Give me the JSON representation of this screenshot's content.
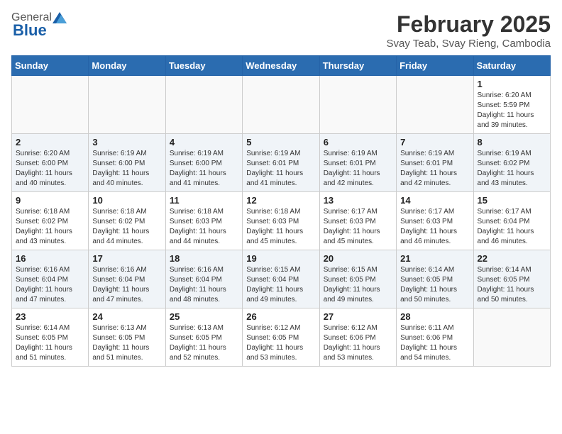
{
  "header": {
    "logo_general": "General",
    "logo_blue": "Blue",
    "month_title": "February 2025",
    "location": "Svay Teab, Svay Rieng, Cambodia"
  },
  "weekdays": [
    "Sunday",
    "Monday",
    "Tuesday",
    "Wednesday",
    "Thursday",
    "Friday",
    "Saturday"
  ],
  "weeks": [
    [
      {
        "day": "",
        "sunrise": "",
        "sunset": "",
        "daylight": ""
      },
      {
        "day": "",
        "sunrise": "",
        "sunset": "",
        "daylight": ""
      },
      {
        "day": "",
        "sunrise": "",
        "sunset": "",
        "daylight": ""
      },
      {
        "day": "",
        "sunrise": "",
        "sunset": "",
        "daylight": ""
      },
      {
        "day": "",
        "sunrise": "",
        "sunset": "",
        "daylight": ""
      },
      {
        "day": "",
        "sunrise": "",
        "sunset": "",
        "daylight": ""
      },
      {
        "day": "1",
        "sunrise": "Sunrise: 6:20 AM",
        "sunset": "Sunset: 5:59 PM",
        "daylight": "Daylight: 11 hours and 39 minutes."
      }
    ],
    [
      {
        "day": "2",
        "sunrise": "Sunrise: 6:20 AM",
        "sunset": "Sunset: 6:00 PM",
        "daylight": "Daylight: 11 hours and 40 minutes."
      },
      {
        "day": "3",
        "sunrise": "Sunrise: 6:19 AM",
        "sunset": "Sunset: 6:00 PM",
        "daylight": "Daylight: 11 hours and 40 minutes."
      },
      {
        "day": "4",
        "sunrise": "Sunrise: 6:19 AM",
        "sunset": "Sunset: 6:00 PM",
        "daylight": "Daylight: 11 hours and 41 minutes."
      },
      {
        "day": "5",
        "sunrise": "Sunrise: 6:19 AM",
        "sunset": "Sunset: 6:01 PM",
        "daylight": "Daylight: 11 hours and 41 minutes."
      },
      {
        "day": "6",
        "sunrise": "Sunrise: 6:19 AM",
        "sunset": "Sunset: 6:01 PM",
        "daylight": "Daylight: 11 hours and 42 minutes."
      },
      {
        "day": "7",
        "sunrise": "Sunrise: 6:19 AM",
        "sunset": "Sunset: 6:01 PM",
        "daylight": "Daylight: 11 hours and 42 minutes."
      },
      {
        "day": "8",
        "sunrise": "Sunrise: 6:19 AM",
        "sunset": "Sunset: 6:02 PM",
        "daylight": "Daylight: 11 hours and 43 minutes."
      }
    ],
    [
      {
        "day": "9",
        "sunrise": "Sunrise: 6:18 AM",
        "sunset": "Sunset: 6:02 PM",
        "daylight": "Daylight: 11 hours and 43 minutes."
      },
      {
        "day": "10",
        "sunrise": "Sunrise: 6:18 AM",
        "sunset": "Sunset: 6:02 PM",
        "daylight": "Daylight: 11 hours and 44 minutes."
      },
      {
        "day": "11",
        "sunrise": "Sunrise: 6:18 AM",
        "sunset": "Sunset: 6:03 PM",
        "daylight": "Daylight: 11 hours and 44 minutes."
      },
      {
        "day": "12",
        "sunrise": "Sunrise: 6:18 AM",
        "sunset": "Sunset: 6:03 PM",
        "daylight": "Daylight: 11 hours and 45 minutes."
      },
      {
        "day": "13",
        "sunrise": "Sunrise: 6:17 AM",
        "sunset": "Sunset: 6:03 PM",
        "daylight": "Daylight: 11 hours and 45 minutes."
      },
      {
        "day": "14",
        "sunrise": "Sunrise: 6:17 AM",
        "sunset": "Sunset: 6:03 PM",
        "daylight": "Daylight: 11 hours and 46 minutes."
      },
      {
        "day": "15",
        "sunrise": "Sunrise: 6:17 AM",
        "sunset": "Sunset: 6:04 PM",
        "daylight": "Daylight: 11 hours and 46 minutes."
      }
    ],
    [
      {
        "day": "16",
        "sunrise": "Sunrise: 6:16 AM",
        "sunset": "Sunset: 6:04 PM",
        "daylight": "Daylight: 11 hours and 47 minutes."
      },
      {
        "day": "17",
        "sunrise": "Sunrise: 6:16 AM",
        "sunset": "Sunset: 6:04 PM",
        "daylight": "Daylight: 11 hours and 47 minutes."
      },
      {
        "day": "18",
        "sunrise": "Sunrise: 6:16 AM",
        "sunset": "Sunset: 6:04 PM",
        "daylight": "Daylight: 11 hours and 48 minutes."
      },
      {
        "day": "19",
        "sunrise": "Sunrise: 6:15 AM",
        "sunset": "Sunset: 6:04 PM",
        "daylight": "Daylight: 11 hours and 49 minutes."
      },
      {
        "day": "20",
        "sunrise": "Sunrise: 6:15 AM",
        "sunset": "Sunset: 6:05 PM",
        "daylight": "Daylight: 11 hours and 49 minutes."
      },
      {
        "day": "21",
        "sunrise": "Sunrise: 6:14 AM",
        "sunset": "Sunset: 6:05 PM",
        "daylight": "Daylight: 11 hours and 50 minutes."
      },
      {
        "day": "22",
        "sunrise": "Sunrise: 6:14 AM",
        "sunset": "Sunset: 6:05 PM",
        "daylight": "Daylight: 11 hours and 50 minutes."
      }
    ],
    [
      {
        "day": "23",
        "sunrise": "Sunrise: 6:14 AM",
        "sunset": "Sunset: 6:05 PM",
        "daylight": "Daylight: 11 hours and 51 minutes."
      },
      {
        "day": "24",
        "sunrise": "Sunrise: 6:13 AM",
        "sunset": "Sunset: 6:05 PM",
        "daylight": "Daylight: 11 hours and 51 minutes."
      },
      {
        "day": "25",
        "sunrise": "Sunrise: 6:13 AM",
        "sunset": "Sunset: 6:05 PM",
        "daylight": "Daylight: 11 hours and 52 minutes."
      },
      {
        "day": "26",
        "sunrise": "Sunrise: 6:12 AM",
        "sunset": "Sunset: 6:05 PM",
        "daylight": "Daylight: 11 hours and 53 minutes."
      },
      {
        "day": "27",
        "sunrise": "Sunrise: 6:12 AM",
        "sunset": "Sunset: 6:06 PM",
        "daylight": "Daylight: 11 hours and 53 minutes."
      },
      {
        "day": "28",
        "sunrise": "Sunrise: 6:11 AM",
        "sunset": "Sunset: 6:06 PM",
        "daylight": "Daylight: 11 hours and 54 minutes."
      },
      {
        "day": "",
        "sunrise": "",
        "sunset": "",
        "daylight": ""
      }
    ]
  ]
}
